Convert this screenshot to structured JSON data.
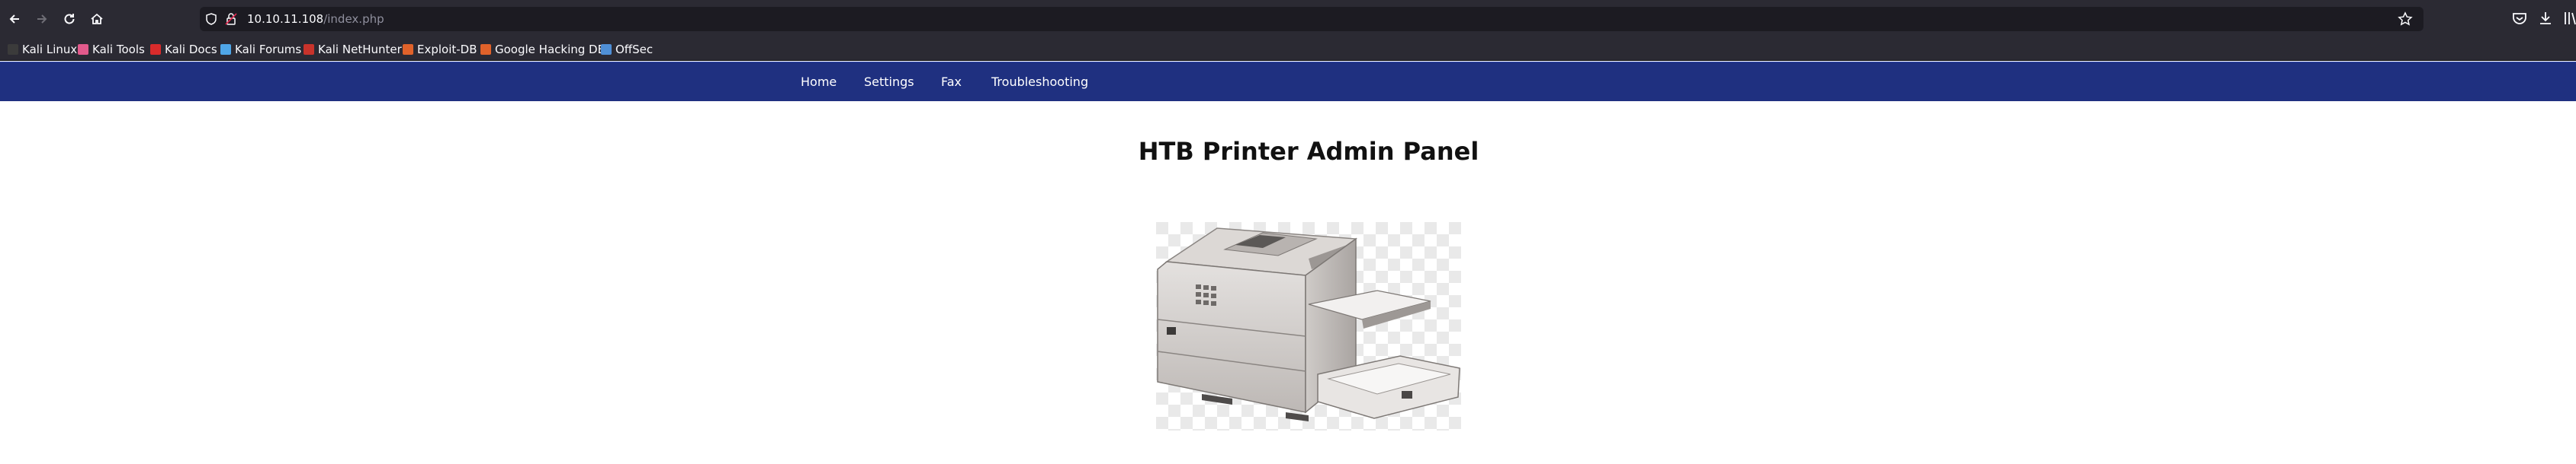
{
  "browser": {
    "url_host": "10.10.11.108",
    "url_path": "/index.php"
  },
  "bookmarks": [
    {
      "label": "Kali Linux",
      "color": "#3b3b3b"
    },
    {
      "label": "Kali Tools",
      "color": "#e25a8c"
    },
    {
      "label": "Kali Docs",
      "color": "#d92b2b"
    },
    {
      "label": "Kali Forums",
      "color": "#4fa6e8"
    },
    {
      "label": "Kali NetHunter",
      "color": "#c8332b"
    },
    {
      "label": "Exploit-DB",
      "color": "#e0622a"
    },
    {
      "label": "Google Hacking DB",
      "color": "#e0622a"
    },
    {
      "label": "OffSec",
      "color": "#4f8fd6"
    }
  ],
  "nav": {
    "home": "Home",
    "settings": "Settings",
    "fax": "Fax",
    "troubleshooting": "Troubleshooting"
  },
  "page": {
    "title": "HTB Printer Admin Panel"
  },
  "colors": {
    "navbar": "#1f3080",
    "browser_chrome": "#2b2a33"
  }
}
